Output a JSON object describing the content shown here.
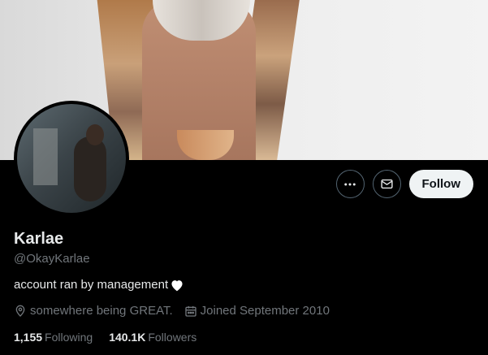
{
  "profile": {
    "name": "Karlae",
    "handle": "@OkayKarlae",
    "bio": "account ran by management",
    "location": "somewhere being GREAT.",
    "joined": "Joined September 2010"
  },
  "actions": {
    "follow_label": "Follow"
  },
  "stats": {
    "following_count": "1,155",
    "following_label": "Following",
    "followers_count": "140.1K",
    "followers_label": "Followers"
  },
  "icons": {
    "more": "more-dots-icon",
    "message": "envelope-icon",
    "location": "map-pin-icon",
    "calendar": "calendar-icon",
    "heart": "white-heart-icon"
  },
  "colors": {
    "background": "#000000",
    "text_primary": "#e7e9ea",
    "text_secondary": "#71767b",
    "follow_bg": "#eff3f4"
  }
}
